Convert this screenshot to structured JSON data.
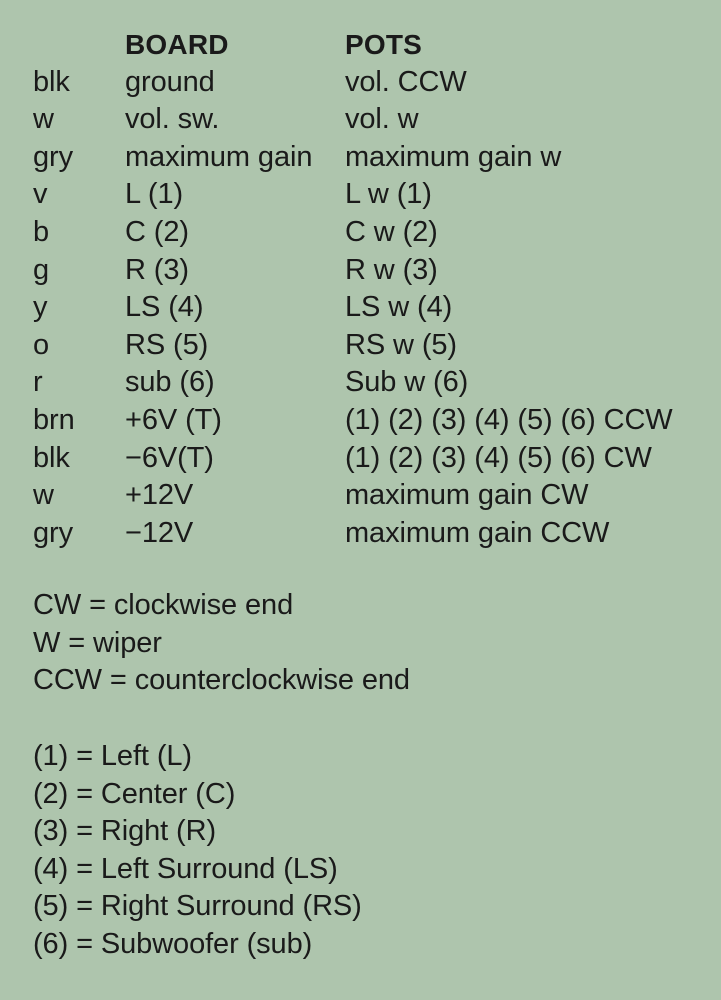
{
  "table": {
    "columns": {
      "wire_header": "",
      "board_header": "BOARD",
      "pots_header": "POTS"
    },
    "rows": [
      {
        "wire": "blk",
        "board": "ground",
        "pots": "vol. CCW"
      },
      {
        "wire": "w",
        "board": "vol. sw.",
        "pots": "vol. w"
      },
      {
        "wire": "gry",
        "board": "maximum gain",
        "pots": "maximum gain w"
      },
      {
        "wire": "v",
        "board": "L (1)",
        "pots": "L w (1)"
      },
      {
        "wire": "b",
        "board": "C (2)",
        "pots": "C w (2)"
      },
      {
        "wire": "g",
        "board": "R (3)",
        "pots": "R w (3)"
      },
      {
        "wire": "y",
        "board": "LS (4)",
        "pots": "LS w (4)"
      },
      {
        "wire": "o",
        "board": "RS (5)",
        "pots": "RS w (5)"
      },
      {
        "wire": "r",
        "board": "sub (6)",
        "pots": "Sub w (6)"
      },
      {
        "wire": "brn",
        "board": "+6V (T)",
        "pots": "(1) (2) (3) (4) (5) (6) CCW"
      },
      {
        "wire": "blk",
        "board": "−6V(T)",
        "pots": "(1) (2) (3) (4) (5) (6) CW"
      },
      {
        "wire": "w",
        "board": "+12V",
        "pots": "maximum gain CW"
      },
      {
        "wire": "gry",
        "board": "−12V",
        "pots": "maximum gain CCW"
      }
    ]
  },
  "legend_rotation": {
    "lines": [
      "CW = clockwise end",
      "W = wiper",
      "CCW = counterclockwise end"
    ]
  },
  "legend_channels": {
    "lines": [
      "(1) = Left (L)",
      "(2) = Center (C)",
      "(3) = Right (R)",
      "(4) = Left Surround (LS)",
      "(5) = Right Surround (RS)",
      "(6) = Subwoofer (sub)"
    ]
  },
  "colors": {
    "background": "#aec5ad",
    "text": "#1a1a1a"
  }
}
